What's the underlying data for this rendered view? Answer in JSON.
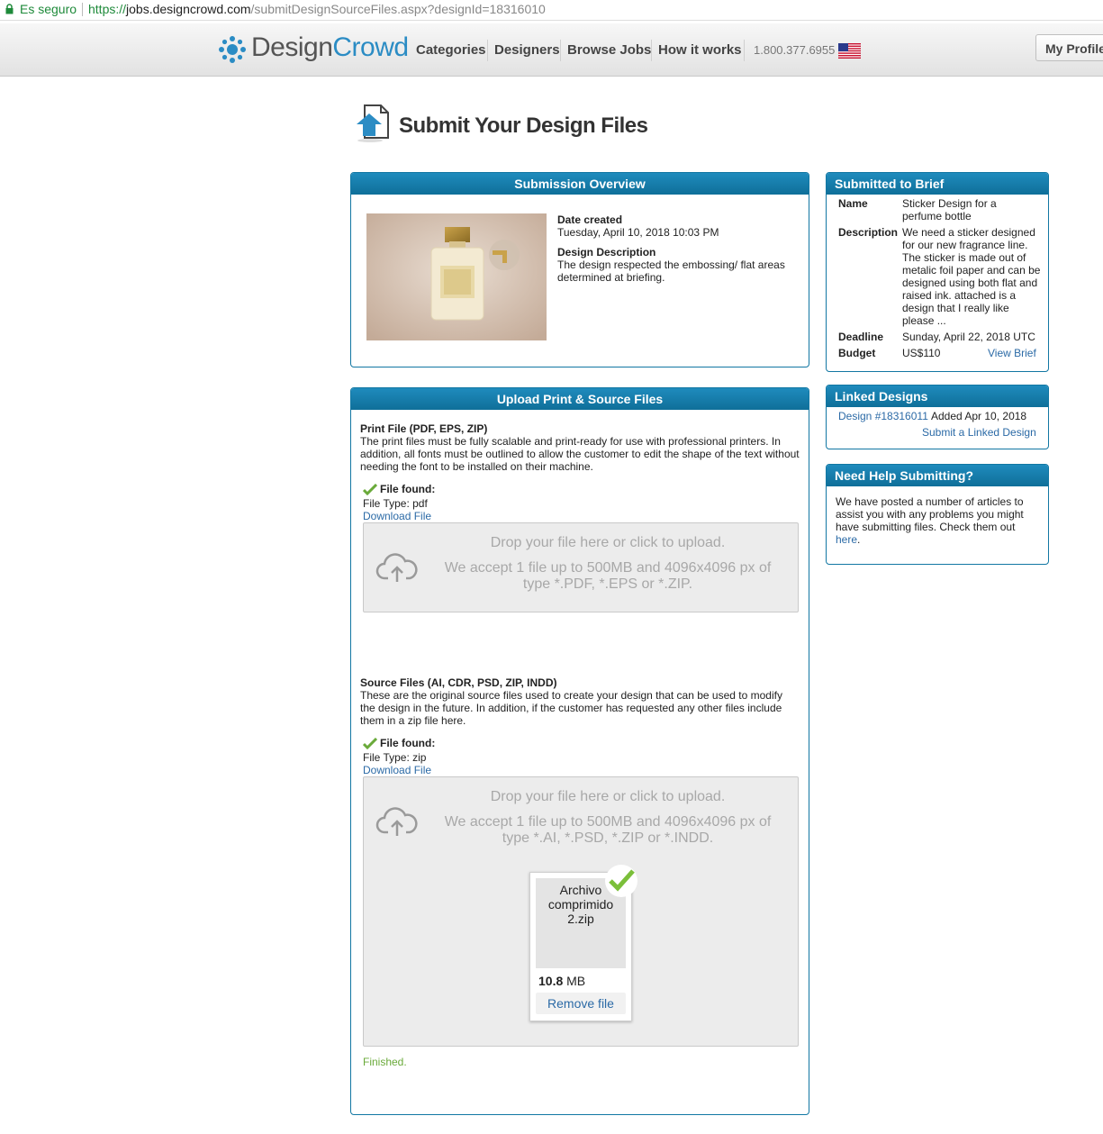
{
  "address_bar": {
    "secure_label": "Es seguro",
    "url_scheme": "https://",
    "url_host": "jobs.designcrowd.com",
    "url_path": "/submitDesignSourceFiles.aspx?designId=18316010"
  },
  "header": {
    "logo_design": "Design",
    "logo_crowd": "Crowd",
    "nav": [
      "Categories",
      "Designers",
      "Browse Jobs",
      "How it works"
    ],
    "phone": "1.800.377.6955",
    "flag_icon": "us-flag-icon",
    "profile_button": "My Profile"
  },
  "page": {
    "title": "Submit Your Design Files"
  },
  "overview": {
    "heading": "Submission Overview",
    "date_label": "Date created",
    "date_value": "Tuesday, April 10, 2018 10:03 PM",
    "desc_label": "Design Description",
    "desc_value": "The design respected the embossing/ flat areas determined at briefing."
  },
  "upload": {
    "heading": "Upload Print & Source Files",
    "print": {
      "title": "Print File (PDF, EPS, ZIP)",
      "description": "The print files must be fully scalable and print-ready for use with professional printers. In addition, all fonts must be outlined to allow the customer to edit the shape of the text without needing the font to be installed on their machine.",
      "found_label": "File found:",
      "file_type": "File Type: pdf",
      "download": "Download File",
      "drop_title": "Drop your file here or click to upload.",
      "drop_accept": "We accept 1 file up to 500MB and 4096x4096 px of type *.PDF, *.EPS or *.ZIP."
    },
    "source": {
      "title": "Source Files (AI, CDR, PSD, ZIP, INDD)",
      "description": "These are the original source files used to create your design that can be used to modify the design in the future. In addition, if the customer has requested any other files include them in a zip file here.",
      "found_label": "File found:",
      "file_type": "File Type: zip",
      "download": "Download File",
      "drop_title": "Drop your file here or click to upload.",
      "drop_accept": "We accept 1 file up to 500MB and 4096x4096 px of type *.AI, *.PSD, *.ZIP or *.INDD.",
      "preview_name": "Archivo comprimido 2.zip",
      "preview_size_num": "10.8",
      "preview_size_unit": " MB",
      "remove": "Remove file",
      "status": "Finished."
    }
  },
  "brief": {
    "heading": "Submitted to Brief",
    "name_label": "Name",
    "name_value": "Sticker Design for a perfume bottle",
    "desc_label": "Description",
    "desc_value": "We need a sticker designed for our new fragrance line. The sticker is made out of metalic foil paper and can be designed using both flat and raised ink. attached is a design that I really like please ...",
    "deadline_label": "Deadline",
    "deadline_value": "Sunday, April 22, 2018 UTC",
    "budget_label": "Budget",
    "budget_value": "US$110",
    "view_brief": "View Brief"
  },
  "linked": {
    "heading": "Linked Designs",
    "design_link": "Design #18316011",
    "added": "Added Apr 10, 2018",
    "submit_link": "Submit a Linked Design"
  },
  "help": {
    "heading": "Need Help Submitting?",
    "text": "We have posted a number of articles to assist you with any problems you might have submitting files. Check them out",
    "link": "here",
    "after": "."
  },
  "colors": {
    "brand_blue": "#1277a3",
    "link": "#2b6aa6",
    "secure_green": "#1e8a3a",
    "finished_green": "#6aaa3a"
  }
}
